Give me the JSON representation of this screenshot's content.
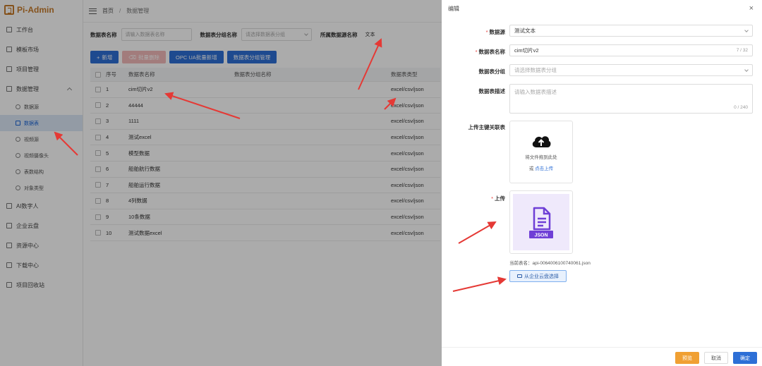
{
  "app": {
    "name": "Pi-Admin"
  },
  "sidebar": {
    "items": [
      {
        "label": "工作台"
      },
      {
        "label": "模板市场"
      },
      {
        "label": "项目管理"
      },
      {
        "label": "数据管理"
      }
    ],
    "sub_items": [
      {
        "label": "数据源"
      },
      {
        "label": "数据表"
      },
      {
        "label": "视频源"
      },
      {
        "label": "视频摄像头"
      },
      {
        "label": "表数结构"
      },
      {
        "label": "对象类型"
      }
    ],
    "bottom_items": [
      {
        "label": "AI数字人"
      },
      {
        "label": "企业云盘"
      },
      {
        "label": "资源中心"
      },
      {
        "label": "下载中心"
      },
      {
        "label": "项目回收站"
      }
    ]
  },
  "breadcrumb": {
    "home": "首页",
    "sep": "/",
    "current": "数据管理"
  },
  "filters": {
    "name_label": "数据表名称",
    "name_placeholder": "请输入数据表名称",
    "group_label": "数据表分组名称",
    "group_placeholder": "请选择数据表分组",
    "source_label": "所属数据源名称",
    "source_value": "文本"
  },
  "toolbar": {
    "add": "新增",
    "batch_delete": "批量删除",
    "opcua": "OPC UA批量新增",
    "group_manage": "数据表分组管理"
  },
  "table": {
    "headers": [
      "序号",
      "数据表名称",
      "数据表分组名称",
      "数据表类型"
    ],
    "rows": [
      [
        "1",
        "cim切片v2",
        "",
        "excel/csv/json"
      ],
      [
        "2",
        "44444",
        "",
        "excel/csv/json"
      ],
      [
        "3",
        "1111",
        "",
        "excel/csv/json"
      ],
      [
        "4",
        "测试excel",
        "",
        "excel/csv/json"
      ],
      [
        "5",
        "模型数据",
        "",
        "excel/csv/json"
      ],
      [
        "6",
        "船舶航行数据",
        "",
        "excel/csv/json"
      ],
      [
        "7",
        "船舶运行数据",
        "",
        "excel/csv/json"
      ],
      [
        "8",
        "4列数据",
        "",
        "excel/csv/json"
      ],
      [
        "9",
        "10条数据",
        "",
        "excel/csv/json"
      ],
      [
        "10",
        "测试数据excel",
        "",
        "excel/csv/json"
      ]
    ]
  },
  "drawer": {
    "title": "编辑",
    "close": "×",
    "source_label": "数据源",
    "source_value": "测试文本",
    "name_label": "数据表名称",
    "name_value": "cim切片v2",
    "name_count": "7 / 32",
    "group_label": "数据表分组",
    "group_placeholder": "请选择数据表分组",
    "desc_label": "数据表描述",
    "desc_placeholder": "请输入数据表描述",
    "desc_count": "0 / 240",
    "upload_related_label": "上传主键关联表",
    "upload_drag": "将文件拖到此处",
    "upload_or": "或",
    "upload_click": "点击上传",
    "upload_label": "上传",
    "file_badge": "JSON",
    "current_file": "当前表名：api-0064006100740061.json",
    "cloud_select": "从企业云盘选择",
    "btn_preview": "预览",
    "btn_cancel": "取消",
    "btn_ok": "确定"
  },
  "colors": {
    "primary": "#2d6fd6",
    "brand": "#c77b2b",
    "warning": "#f0a033",
    "arrow": "#e53935"
  }
}
